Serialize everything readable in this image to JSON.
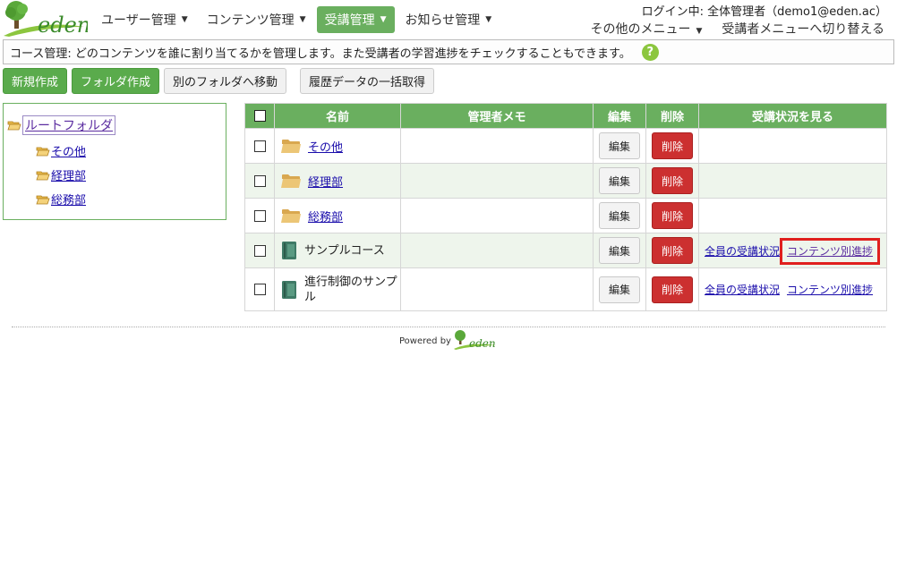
{
  "brand": {
    "logo_text": "eden",
    "powered_by": "Powered by"
  },
  "nav": {
    "items": [
      {
        "label": "ユーザー管理"
      },
      {
        "label": "コンテンツ管理"
      },
      {
        "label": "受講管理"
      },
      {
        "label": "お知らせ管理"
      }
    ],
    "active_index": 2
  },
  "header": {
    "login_info": "ログイン中: 全体管理者（demo1@eden.ac）",
    "other_menu": "その他のメニュー",
    "switch_menu": "受講者メニューへ切り替える"
  },
  "info_bar": {
    "text": "コース管理: どのコンテンツを誰に割り当てるかを管理します。また受講者の学習進捗をチェックすることもできます。",
    "help_icon": "?"
  },
  "toolbar": {
    "new": "新規作成",
    "new_folder": "フォルダ作成",
    "move": "別のフォルダへ移動",
    "history": "履歴データの一括取得"
  },
  "tree": {
    "root": "ルートフォルダ",
    "children": [
      "その他",
      "経理部",
      "総務部"
    ]
  },
  "table": {
    "headers": [
      "名前",
      "管理者メモ",
      "編集",
      "削除",
      "受講状況を見る"
    ],
    "edit_label": "編集",
    "delete_label": "削除",
    "rows": [
      {
        "type": "folder",
        "name": "その他",
        "memo": ""
      },
      {
        "type": "folder",
        "name": "経理部",
        "memo": ""
      },
      {
        "type": "folder",
        "name": "総務部",
        "memo": ""
      },
      {
        "type": "course",
        "name": "サンプルコース",
        "memo": "",
        "status_all": "全員の受講状況",
        "status_content": "コンテンツ別進捗"
      },
      {
        "type": "course",
        "name": "進行制御のサンプル",
        "memo": "",
        "status_all": "全員の受講状況",
        "status_content": "コンテンツ別進捗"
      }
    ]
  },
  "colors": {
    "accent_green": "#6aaf5f",
    "delete_red": "#cc3030",
    "highlight_red": "#e0201e",
    "help_green": "#8cc63f"
  }
}
